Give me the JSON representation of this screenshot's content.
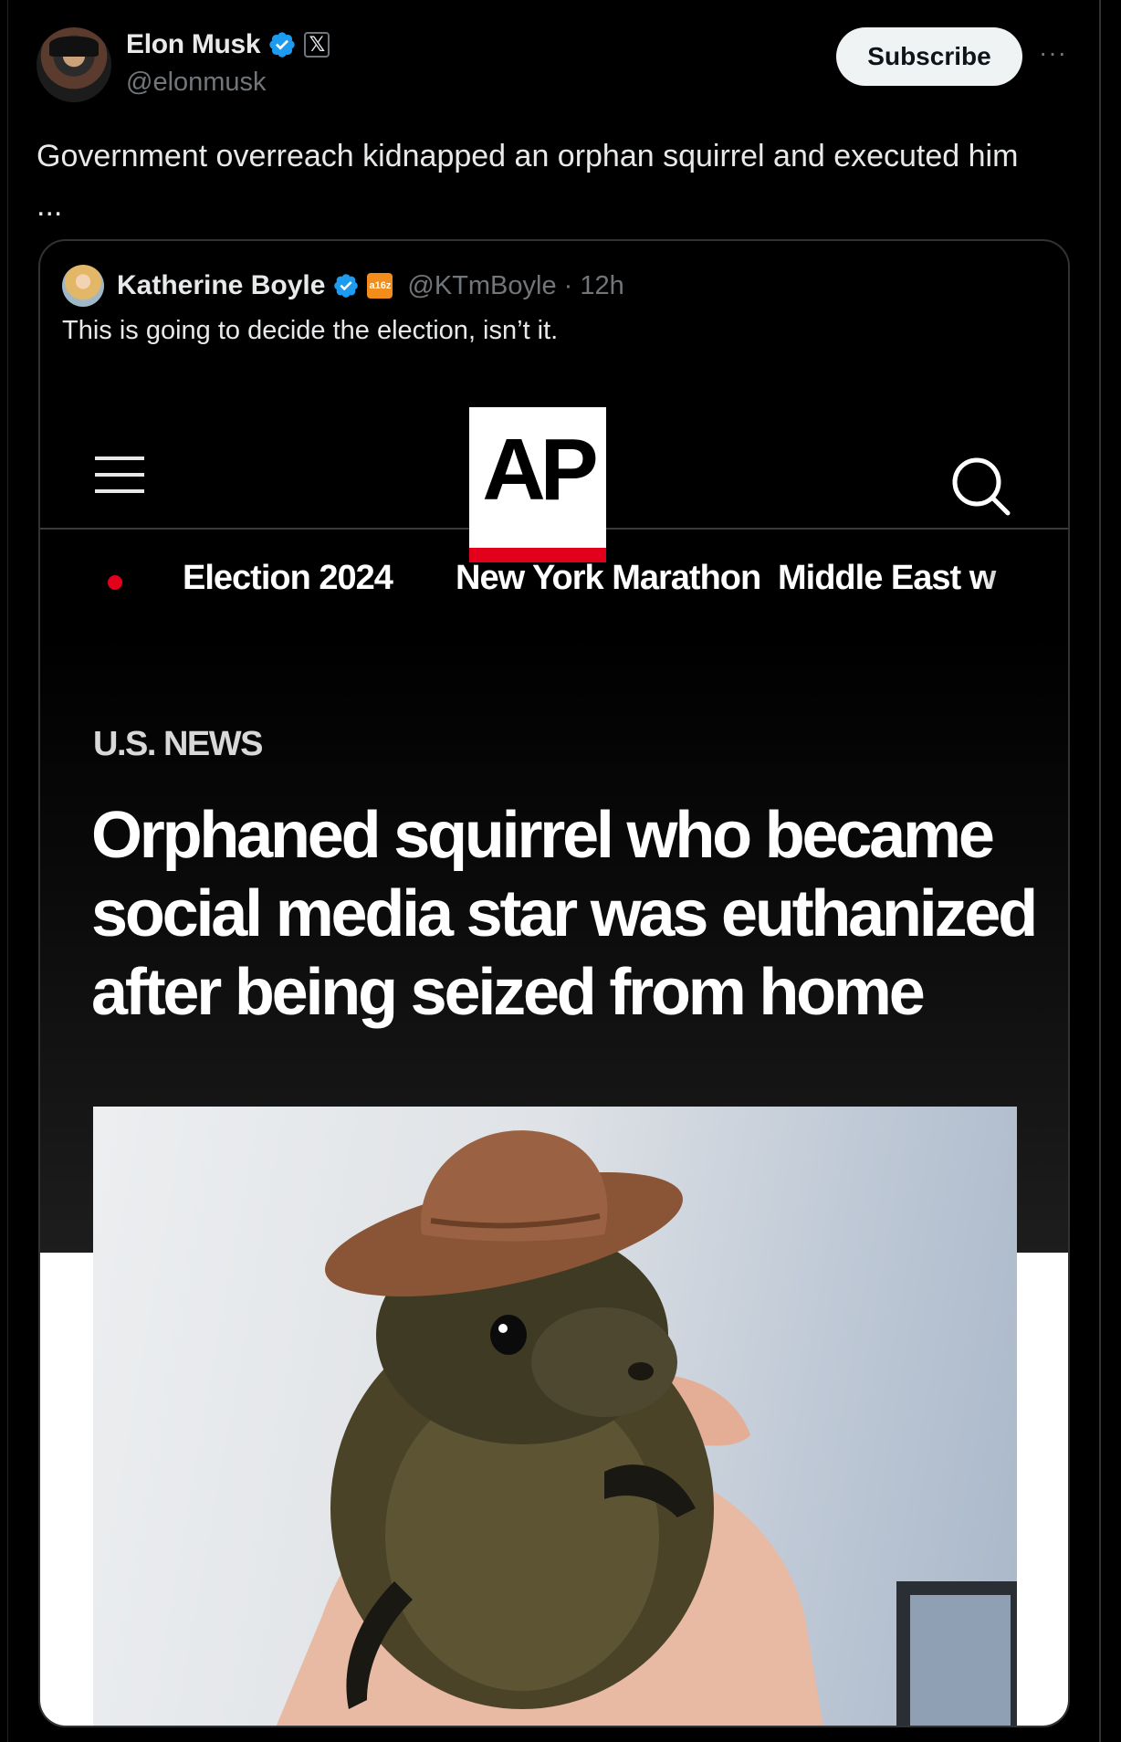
{
  "author": {
    "name": "Elon Musk",
    "handle": "@elonmusk",
    "x_badge": "𝕏",
    "subscribe_label": "Subscribe",
    "more_label": "···"
  },
  "tweet": {
    "text": "Government overreach kidnapped an orphan squirrel and executed him",
    "ellipsis": "..."
  },
  "quote": {
    "name": "Katherine Boyle",
    "org_badge": "a16z",
    "handle": "@KTmBoyle",
    "time": "· 12h",
    "text": "This is going to decide the election, isn’t it."
  },
  "ap": {
    "logo": "AP",
    "nav": [
      "Election 2024",
      "New York Marathon",
      "Middle East w"
    ],
    "section": "U.S. NEWS",
    "headline": "Orphaned squirrel who became social media star was euthanized after being seized from home"
  },
  "colors": {
    "background": "#000000",
    "verified_blue": "#1d9bf0",
    "ap_red": "#e3001b",
    "muted": "#71767b"
  }
}
